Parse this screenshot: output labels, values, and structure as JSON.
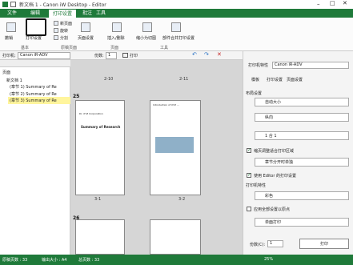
{
  "window": {
    "title": "新文档 1 - Canon iW Desktop - Editor"
  },
  "tabs": [
    "文件",
    "编辑",
    "打印设置",
    "批注",
    "工具"
  ],
  "ribbon": {
    "groups": [
      "基本",
      "原稿页面",
      "页面",
      "工具"
    ],
    "buttons": {
      "undo": "撤销",
      "print_settings": "打印设置",
      "new_page": "新页面",
      "rotate": "旋转",
      "split": "分割",
      "page_layout": "页面设置",
      "insert_delete": "插入/删除",
      "merge_image": "缩小为切图",
      "share_print": "部件合并打印设置"
    }
  },
  "toolbar": {
    "printer_label": "打印机:",
    "printer_value": "Canon iR-ADV",
    "copies_label": "份数:",
    "copies_value": "1",
    "print_label": "打印"
  },
  "left_panel": {
    "header": "页面",
    "tree": [
      "新文档 1",
      "(章节 1) Summary of Re",
      "(章节 2) Summary of Re",
      "(章节 3) Summary of Re"
    ]
  },
  "center": {
    "top_labels": [
      "2-10",
      "2-11"
    ],
    "sections": [
      {
        "label": "25",
        "pages": [
          {
            "num": "3-1",
            "title": "Summary of Research",
            "org": "Dr. XYZ Corporation"
          },
          {
            "num": "3-2",
            "title": "Introduction of XYZ ...",
            "org": ""
          }
        ]
      },
      {
        "label": "26",
        "pages": []
      }
    ]
  },
  "right_panel": {
    "header_label": "打印机特性",
    "printer_value": "Canon iR-ADV",
    "tabs": [
      "模板",
      "打印设置",
      "页面设置"
    ],
    "layout_label": "布局设置",
    "size_value": "自动大小",
    "paper_value": "纵向",
    "pages_per_sheet": "1 合 1",
    "chk1": "缩页调整适合打印区域",
    "chk2": "章节分开时单独",
    "chk3": "使用 Editor 的打印设置",
    "color_label": "打印机特性",
    "color_value": "彩色",
    "chk4": "应用全部设置以原点",
    "duplex_value": "单面打印",
    "copies_label": "份数(C):",
    "copies_value": "1",
    "print_button": "打印"
  },
  "status": {
    "total_pages": "原稿页数 : 33",
    "output_size": "输出大小 : A4",
    "print_pages": "总页数 : 33",
    "zoom": "25%"
  }
}
